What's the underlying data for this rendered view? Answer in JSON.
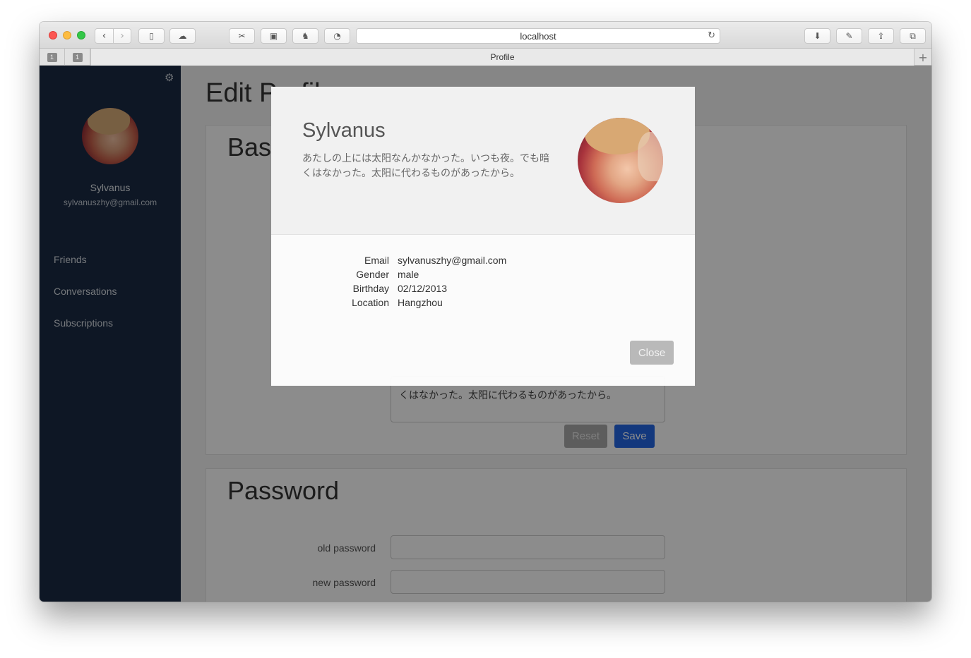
{
  "browser": {
    "address": "localhost",
    "tab_title": "Profile",
    "pinned_tabs": [
      "1",
      "1"
    ]
  },
  "sidebar": {
    "user_name": "Sylvanus",
    "user_email": "sylvanuszhy@gmail.com",
    "nav": [
      "Friends",
      "Conversations",
      "Subscriptions"
    ]
  },
  "main": {
    "title": "Edit Profile",
    "basic_panel_title": "Basic",
    "bio_text": "くはなかった。太阳に代わるものがあったから。",
    "reset_label": "Reset",
    "save_label": "Save",
    "password_panel_title": "Password",
    "old_password_label": "old password",
    "new_password_label": "new password"
  },
  "modal": {
    "name": "Sylvanus",
    "bio": "あたしの上には太阳なんかなかった。いつも夜。でも暗くはなかった。太阳に代わるものがあったから。",
    "fields": [
      {
        "key": "Email",
        "value": "sylvanuszhy@gmail.com"
      },
      {
        "key": "Gender",
        "value": "male"
      },
      {
        "key": "Birthday",
        "value": "02/12/2013"
      },
      {
        "key": "Location",
        "value": "Hangzhou"
      }
    ],
    "close_label": "Close"
  },
  "colors": {
    "sidebar": "#1a2b44",
    "primary": "#2467e4",
    "close_button": "#b9b9b9"
  }
}
